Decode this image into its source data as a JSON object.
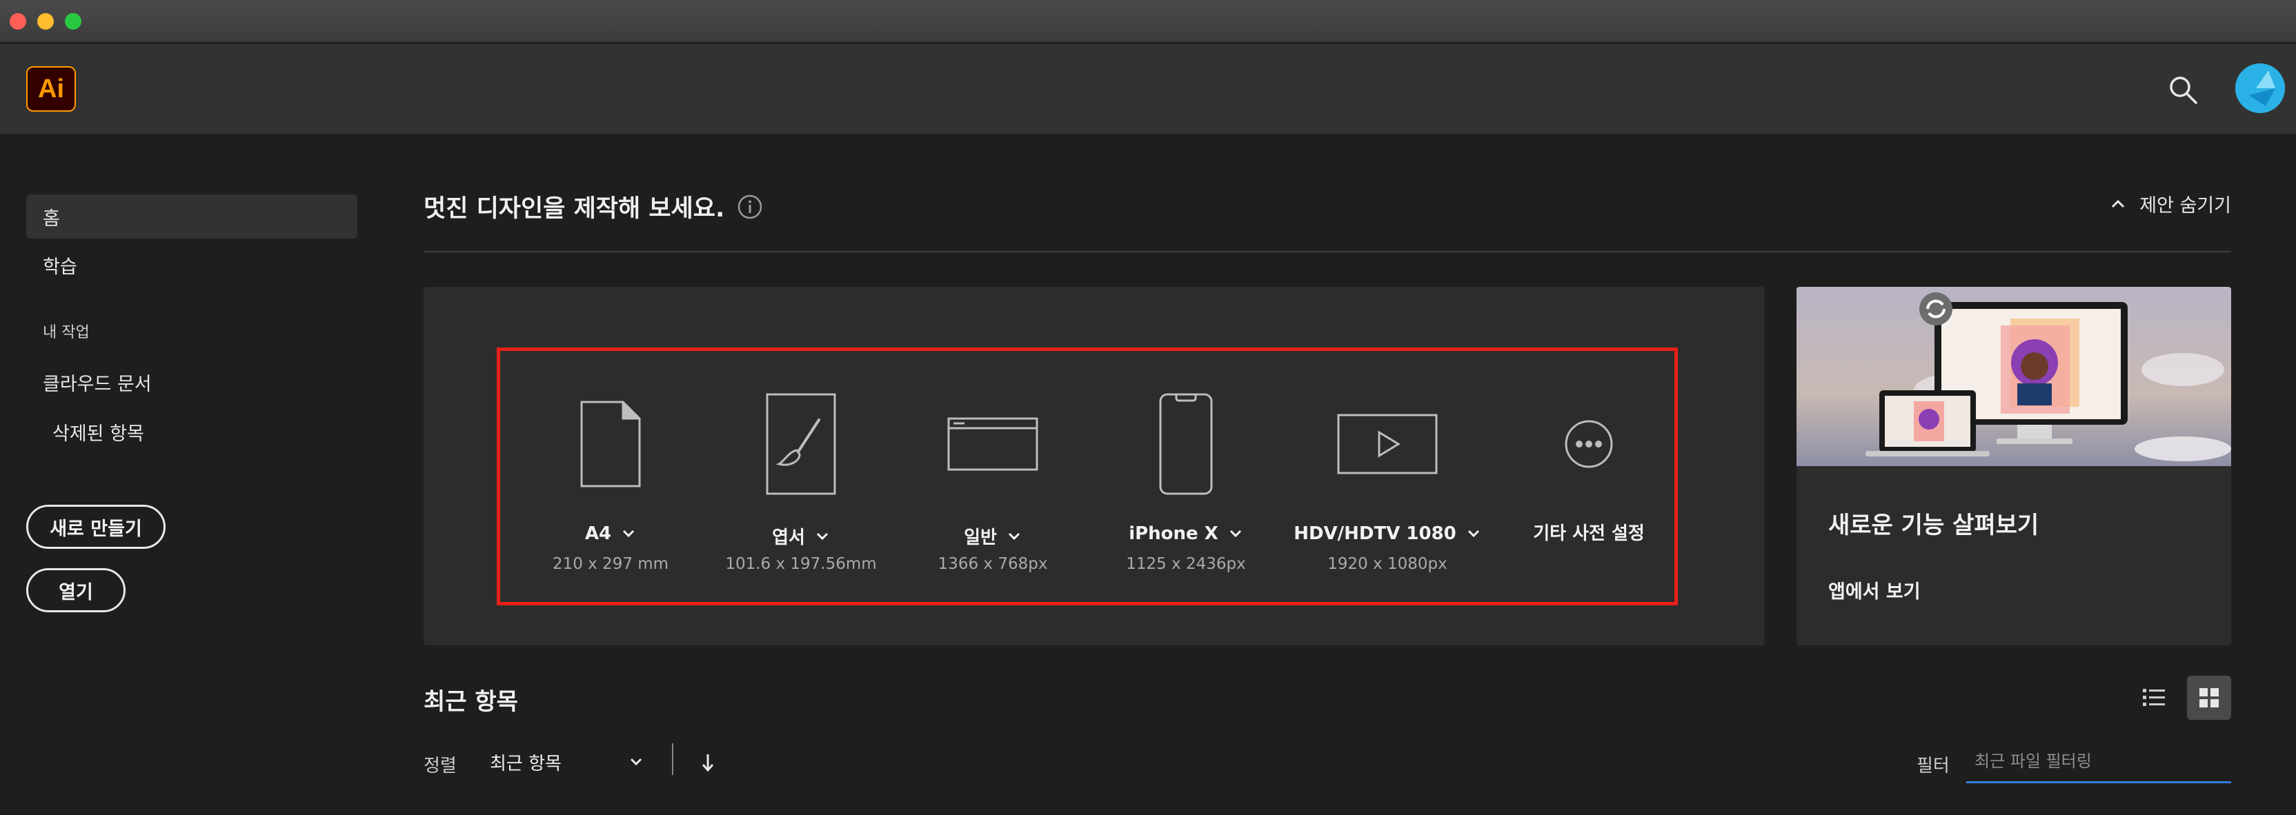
{
  "app": {
    "logo_text": "Ai",
    "brand_color": "#ff9a00"
  },
  "sidebar": {
    "items": [
      {
        "label": "홈",
        "active": true
      },
      {
        "label": "학습",
        "active": false
      }
    ],
    "section_label": "내 작업",
    "work_items": [
      {
        "label": "클라우드 문서"
      },
      {
        "label": "삭제된 항목"
      }
    ],
    "new_button": "새로 만들기",
    "open_button": "열기"
  },
  "main": {
    "heading": "멋진 디자인을 제작해 보세요.",
    "hide_label": "제안 숨기기",
    "presets": [
      {
        "name": "A4",
        "size": "210 x 297 mm",
        "icon": "document-icon"
      },
      {
        "name": "엽서",
        "size": "101.6 x 197.56mm",
        "icon": "brush-document-icon"
      },
      {
        "name": "일반",
        "size": "1366 x 768px",
        "icon": "browser-window-icon"
      },
      {
        "name": "iPhone X",
        "size": "1125 x 2436px",
        "icon": "phone-icon"
      },
      {
        "name": "HDV/HDTV 1080",
        "size": "1920 x 1080px",
        "icon": "video-play-icon"
      },
      {
        "name": "기타 사전 설정",
        "size": "",
        "icon": "more-icon"
      }
    ],
    "promo": {
      "title": "새로운 기능 살펴보기",
      "link": "앱에서 보기"
    },
    "recent": {
      "title": "최근 항목",
      "sort_label": "정렬",
      "sort_value": "최근 항목",
      "filter_label": "필터",
      "filter_placeholder": "최근 파일 필터링",
      "filter_value": ""
    }
  },
  "colors": {
    "accent_blue": "#3b7ddb",
    "highlight_red": "#e8201b",
    "avatar": "#30b8ec"
  }
}
